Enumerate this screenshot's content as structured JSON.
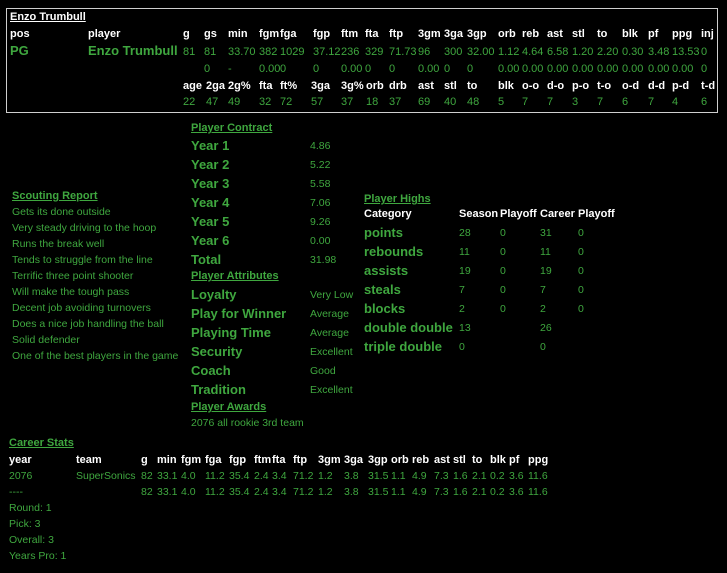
{
  "player_name": "Enzo Trumbull",
  "header": {
    "labels_row1": [
      "pos",
      "player",
      "g",
      "gs",
      "min",
      "fgm",
      "fga",
      "fgp",
      "ftm",
      "fta",
      "ftp",
      "3gm",
      "3ga",
      "3gp",
      "orb",
      "reb",
      "ast",
      "stl",
      "to",
      "blk",
      "pf",
      "ppg",
      "inj"
    ],
    "values_row1": [
      "PG",
      "Enzo Trumbull",
      "81",
      "81",
      "33.70",
      "382",
      "1029",
      "37.12",
      "236",
      "329",
      "71.73",
      "96",
      "300",
      "32.00",
      "1.12",
      "4.64",
      "6.58",
      "1.20",
      "2.20",
      "0.30",
      "3.48",
      "13.53",
      "0"
    ],
    "values_row2": [
      "0",
      "-",
      "0.00",
      "0",
      "0",
      "0.00",
      "0",
      "0",
      "0.00",
      "0",
      "0",
      "0.00",
      "0.00",
      "0.00",
      "0.00",
      "0.00",
      "0.00",
      "0.00",
      "0.00",
      "0"
    ],
    "labels_row3": [
      "age",
      "2ga",
      "2g%",
      "fta",
      "ft%",
      "3ga",
      "3g%",
      "orb",
      "drb",
      "ast",
      "stl",
      "to",
      "blk",
      "o-o",
      "d-o",
      "p-o",
      "t-o",
      "o-d",
      "d-d",
      "p-d",
      "t-d"
    ],
    "values_row3": [
      "22",
      "47",
      "49",
      "32",
      "72",
      "57",
      "37",
      "18",
      "37",
      "69",
      "40",
      "48",
      "5",
      "7",
      "7",
      "3",
      "7",
      "6",
      "7",
      "4",
      "6"
    ]
  },
  "scouting": {
    "title": "Scouting Report",
    "items": [
      "Gets its done outside",
      "Very steady driving to the hoop",
      "Runs the break well",
      "Tends to struggle from the line",
      "Terrific three point shooter",
      "Will make the tough pass",
      "Decent job avoiding turnovers",
      "Does a nice job handling the ball",
      "Solid defender",
      "One of the best players in the game"
    ]
  },
  "contract": {
    "title": "Player Contract",
    "rows": [
      {
        "label": "Year 1",
        "value": "4.86"
      },
      {
        "label": "Year 2",
        "value": "5.22"
      },
      {
        "label": "Year 3",
        "value": "5.58"
      },
      {
        "label": "Year 4",
        "value": "7.06"
      },
      {
        "label": "Year 5",
        "value": "9.26"
      },
      {
        "label": "Year 6",
        "value": "0.00"
      },
      {
        "label": "Total",
        "value": "31.98"
      }
    ]
  },
  "attributes": {
    "title": "Player Attributes",
    "rows": [
      {
        "label": "Loyalty",
        "value": "Very Low"
      },
      {
        "label": "Play for Winner",
        "value": "Average"
      },
      {
        "label": "Playing Time",
        "value": "Average"
      },
      {
        "label": "Security",
        "value": "Excellent"
      },
      {
        "label": "Coach",
        "value": "Good"
      },
      {
        "label": "Tradition",
        "value": "Excellent"
      }
    ]
  },
  "awards": {
    "title": "Player Awards",
    "items": [
      "2076 all rookie 3rd team"
    ]
  },
  "highs": {
    "title": "Player Highs",
    "columns": [
      "Category",
      "Season",
      "Playoff",
      "Career",
      "Playoff"
    ],
    "rows": [
      {
        "category": "points",
        "season": "28",
        "playoff": "0",
        "career": "31",
        "career_playoff": "0"
      },
      {
        "category": "rebounds",
        "season": "11",
        "playoff": "0",
        "career": "11",
        "career_playoff": "0"
      },
      {
        "category": "assists",
        "season": "19",
        "playoff": "0",
        "career": "19",
        "career_playoff": "0"
      },
      {
        "category": "steals",
        "season": "7",
        "playoff": "0",
        "career": "7",
        "career_playoff": "0"
      },
      {
        "category": "blocks",
        "season": "2",
        "playoff": "0",
        "career": "2",
        "career_playoff": "0"
      },
      {
        "category": "double double",
        "season": "13",
        "playoff": "",
        "career": "26",
        "career_playoff": ""
      },
      {
        "category": "triple double",
        "season": "0",
        "playoff": "",
        "career": "0",
        "career_playoff": ""
      }
    ]
  },
  "career": {
    "title": "Career Stats",
    "columns": [
      "year",
      "team",
      "g",
      "min",
      "fgm",
      "fga",
      "fgp",
      "ftm",
      "fta",
      "ftp",
      "3gm",
      "3ga",
      "3gp",
      "orb",
      "reb",
      "ast",
      "stl",
      "to",
      "blk",
      "pf",
      "ppg"
    ],
    "rows": [
      [
        "2076",
        "SuperSonics",
        "82",
        "33.1",
        "4.0",
        "11.2",
        "35.4",
        "2.4",
        "3.4",
        "71.2",
        "1.2",
        "3.8",
        "31.5",
        "1.1",
        "4.9",
        "7.3",
        "1.6",
        "2.1",
        "0.2",
        "3.6",
        "11.6"
      ],
      [
        "----",
        "",
        "82",
        "33.1",
        "4.0",
        "11.2",
        "35.4",
        "2.4",
        "3.4",
        "71.2",
        "1.2",
        "3.8",
        "31.5",
        "1.1",
        "4.9",
        "7.3",
        "1.6",
        "2.1",
        "0.2",
        "3.6",
        "11.6"
      ]
    ]
  },
  "draft": [
    "Round: 1",
    "Pick: 3",
    "Overall: 3",
    "Years Pro: 1"
  ]
}
